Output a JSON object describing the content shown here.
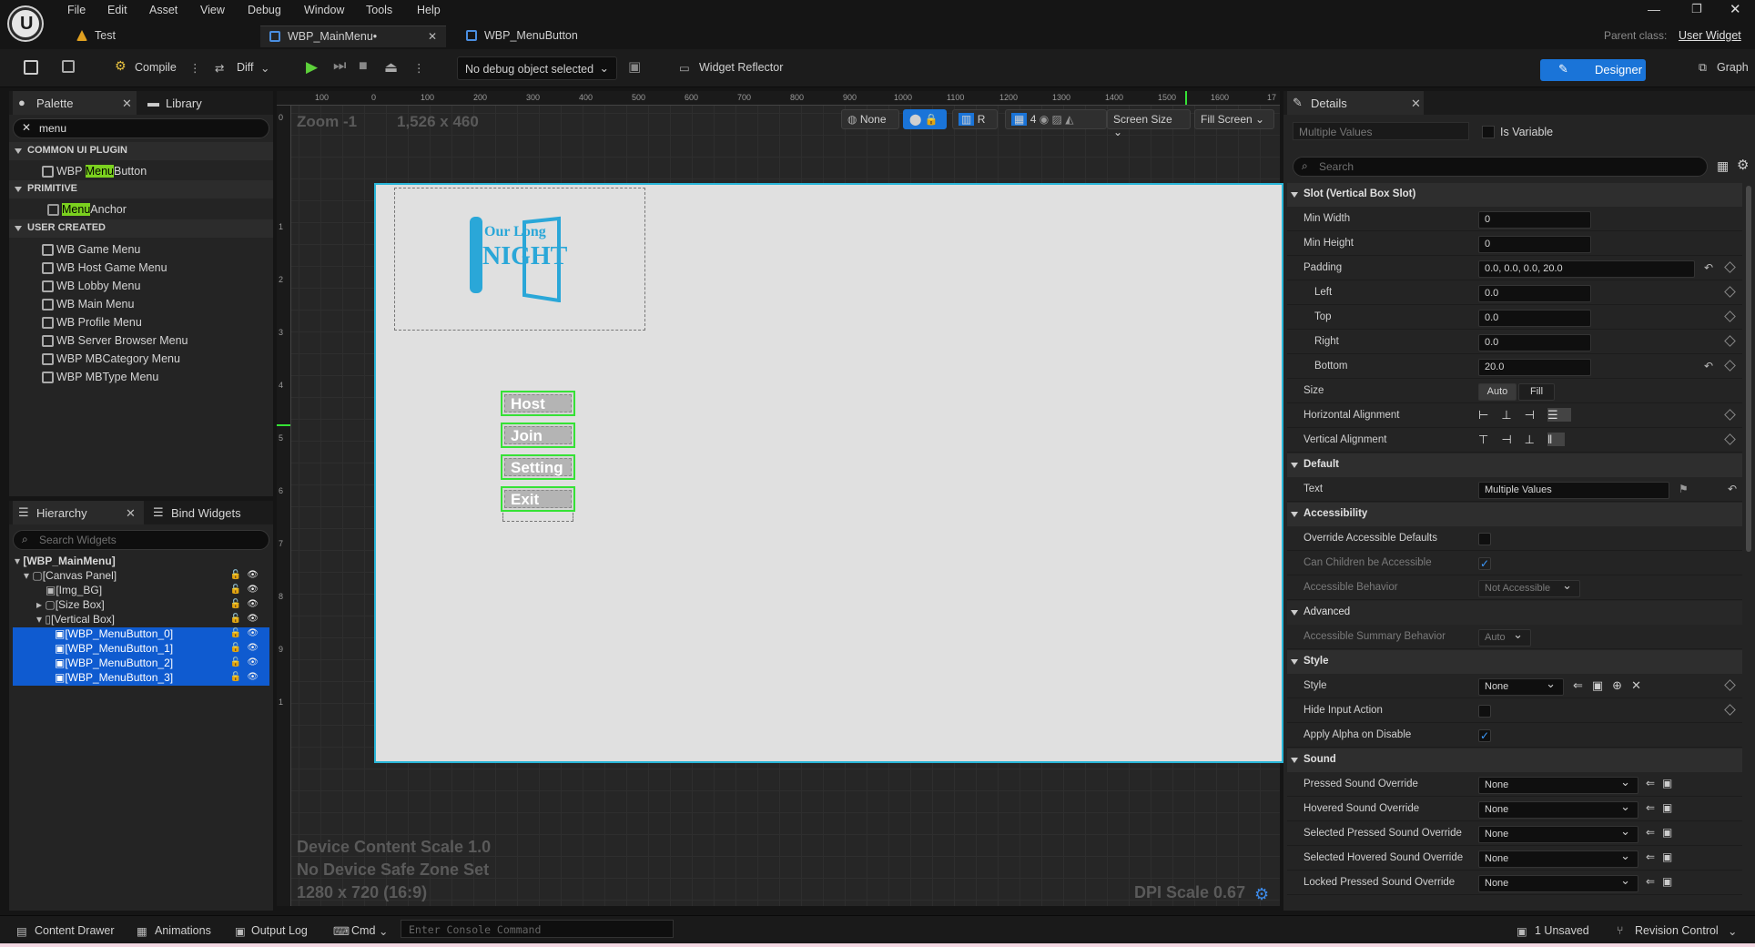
{
  "menubar": {
    "items": [
      "File",
      "Edit",
      "Asset",
      "View",
      "Debug",
      "Window",
      "Tools",
      "Help"
    ]
  },
  "tabs": {
    "test": "Test",
    "main_menu": "WBP_MainMenu•",
    "menu_button": "WBP_MenuButton"
  },
  "parent_class": {
    "label": "Parent class:",
    "value": "User Widget"
  },
  "toolbar": {
    "compile": "Compile",
    "diff": "Diff",
    "debug_object": "No debug object selected",
    "widget_reflector": "Widget Reflector",
    "designer": "Designer",
    "graph": "Graph"
  },
  "palette": {
    "tab": "Palette",
    "library_tab": "Library",
    "search_value": "menu",
    "categories": [
      "COMMON UI PLUGIN",
      "PRIMITIVE",
      "USER CREATED"
    ],
    "common_ui": {
      "pre": "WBP ",
      "match": "Menu",
      "post": "Button"
    },
    "primitive": {
      "pre": "",
      "match": "Menu",
      "post": "Anchor"
    },
    "user_created": [
      "WB Game Menu",
      "WB Host Game Menu",
      "WB Lobby Menu",
      "WB Main Menu",
      "WB Profile Menu",
      "WB Server Browser Menu",
      "WBP MBCategory Menu",
      "WBP MBType Menu"
    ]
  },
  "hierarchy": {
    "tab": "Hierarchy",
    "bind_tab": "Bind Widgets",
    "search_placeholder": "Search Widgets",
    "rows": [
      "[WBP_MainMenu]",
      "[Canvas Panel]",
      "[Img_BG]",
      "[Size Box]",
      "[Vertical Box]",
      "[WBP_MenuButton_0]",
      "[WBP_MenuButton_1]",
      "[WBP_MenuButton_2]",
      "[WBP_MenuButton_3]"
    ]
  },
  "viewport": {
    "zoom": "Zoom -1",
    "resolution": "1,526 x 460",
    "none_label": "None",
    "r_label": "R",
    "grid_num": "4",
    "screen_size": "Screen Size",
    "fill_screen": "Fill Screen",
    "device_scale": "Device Content Scale 1.0",
    "safe_zone": "No Device Safe Zone Set",
    "aspect": "1280 x 720 (16:9)",
    "dpi": "DPI Scale 0.67",
    "ruler_top": [
      "100",
      "0",
      "100",
      "200",
      "300",
      "400",
      "500",
      "600",
      "700",
      "800",
      "900",
      "1000",
      "1100",
      "1200",
      "1300",
      "1400",
      "1500",
      "1600",
      "17"
    ],
    "ruler_left": [
      "0",
      "1",
      "2",
      "3",
      "4",
      "5",
      "6",
      "7",
      "8",
      "9",
      "1"
    ],
    "logo_text": [
      "Our Long",
      "NIGHT"
    ],
    "buttons": [
      "Host",
      "Join",
      "Setting",
      "Exit"
    ]
  },
  "details": {
    "tab": "Details",
    "name_field": "Multiple Values",
    "is_variable": "Is Variable",
    "search_placeholder": "Search",
    "slot_section": "Slot (Vertical Box Slot)",
    "min_width": {
      "label": "Min Width",
      "value": "0"
    },
    "min_height": {
      "label": "Min Height",
      "value": "0"
    },
    "padding": {
      "label": "Padding",
      "value": "0.0, 0.0, 0.0, 20.0"
    },
    "left": {
      "label": "Left",
      "value": "0.0"
    },
    "top": {
      "label": "Top",
      "value": "0.0"
    },
    "right": {
      "label": "Right",
      "value": "0.0"
    },
    "bottom": {
      "label": "Bottom",
      "value": "20.0"
    },
    "size": {
      "label": "Size",
      "auto": "Auto",
      "fill": "Fill"
    },
    "h_align": "Horizontal Alignment",
    "v_align": "Vertical Alignment",
    "default_section": "Default",
    "text": {
      "label": "Text",
      "value": "Multiple Values"
    },
    "accessibility_section": "Accessibility",
    "override_defaults": "Override Accessible Defaults",
    "children_accessible": "Can Children be Accessible",
    "accessible_behavior": {
      "label": "Accessible Behavior",
      "value": "Not Accessible"
    },
    "advanced_section": "Advanced",
    "summary_behavior": {
      "label": "Accessible Summary Behavior",
      "value": "Auto"
    },
    "style_section": "Style",
    "style": {
      "label": "Style",
      "value": "None"
    },
    "hide_input": "Hide Input Action",
    "apply_alpha": "Apply Alpha on Disable",
    "sound_section": "Sound",
    "pressed_sound": {
      "label": "Pressed Sound Override",
      "value": "None"
    },
    "hovered_sound": {
      "label": "Hovered Sound Override",
      "value": "None"
    },
    "sel_pressed_sound": {
      "label": "Selected Pressed Sound Override",
      "value": "None"
    },
    "sel_hovered_sound": {
      "label": "Selected Hovered Sound Override",
      "value": "None"
    },
    "locked_pressed_sound": {
      "label": "Locked Pressed Sound Override",
      "value": "None"
    }
  },
  "statusbar": {
    "content_drawer": "Content Drawer",
    "animations": "Animations",
    "output_log": "Output Log",
    "cmd": "Cmd",
    "console_placeholder": "Enter Console Command",
    "unsaved": "1 Unsaved",
    "revision": "Revision Control"
  }
}
